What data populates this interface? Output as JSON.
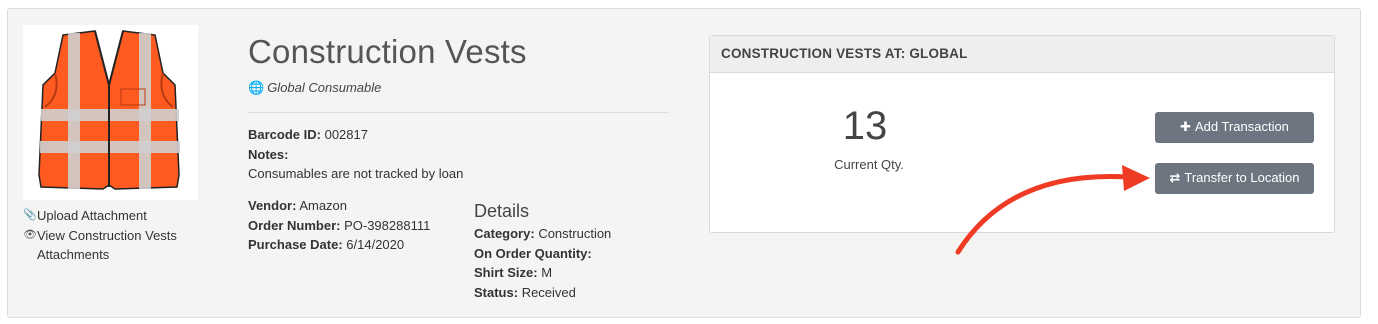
{
  "item": {
    "title": "Construction Vests",
    "subtitle": "Global Consumable",
    "barcode_label": "Barcode ID:",
    "barcode_value": "002817",
    "notes_label": "Notes:",
    "notes_value": "Consumables are not tracked by loan",
    "vendor_label": "Vendor:",
    "vendor_value": "Amazon",
    "order_label": "Order Number:",
    "order_value": "PO-398288111",
    "purchase_label": "Purchase Date:",
    "purchase_value": "6/14/2020"
  },
  "attachments": {
    "upload_label": "Upload Attachment",
    "view_label": "View Construction Vests Attachments"
  },
  "details": {
    "title": "Details",
    "category_label": "Category:",
    "category_value": "Construction",
    "on_order_label": "On Order Quantity:",
    "on_order_value": "",
    "shirt_label": "Shirt Size:",
    "shirt_value": "M",
    "status_label": "Status:",
    "status_value": "Received"
  },
  "panel": {
    "heading": "CONSTRUCTION VESTS AT: GLOBAL",
    "qty_value": "13",
    "qty_label": "Current Qty.",
    "add_button": "Add Transaction",
    "transfer_button": "Transfer to Location"
  },
  "icons": {
    "subtitle": "globe-icon",
    "upload": "paperclip-icon",
    "view": "eye-icon",
    "add": "plus-icon",
    "transfer": "exchange-icon"
  },
  "colors": {
    "button": "#6d7580",
    "arrow": "#ef3b24",
    "vest": "#ff5a1f",
    "reflective": "#c9c9c9"
  }
}
